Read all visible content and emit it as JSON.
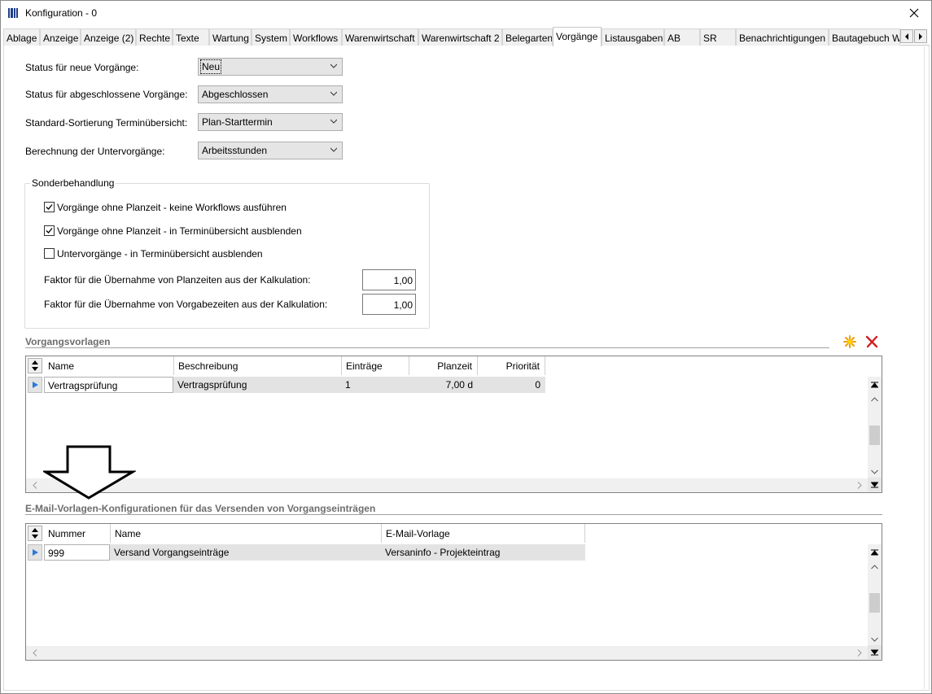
{
  "window": {
    "title": "Konfiguration - 0"
  },
  "tabs": [
    {
      "label": "Ablage"
    },
    {
      "label": "Anzeige"
    },
    {
      "label": "Anzeige (2)"
    },
    {
      "label": "Rechte"
    },
    {
      "label": "Texte"
    },
    {
      "label": "Wartung"
    },
    {
      "label": "System"
    },
    {
      "label": "Workflows"
    },
    {
      "label": "Warenwirtschaft"
    },
    {
      "label": "Warenwirtschaft 2"
    },
    {
      "label": "Belegarten"
    },
    {
      "label": "Vorgänge"
    },
    {
      "label": "Listausgaben"
    },
    {
      "label": "AB"
    },
    {
      "label": "SR"
    },
    {
      "label": "Benachrichtigungen"
    },
    {
      "label": "Bautagebuch W"
    }
  ],
  "active_tab": "Vorgänge",
  "form": {
    "status_new_label": "Status für neue Vorgänge:",
    "status_new_value": "Neu",
    "status_closed_label": "Status für abgeschlossene Vorgänge:",
    "status_closed_value": "Abgeschlossen",
    "sort_label": "Standard-Sortierung Terminübersicht:",
    "sort_value": "Plan-Starttermin",
    "calc_label": "Berechnung der Untervorgänge:",
    "calc_value": "Arbeitsstunden"
  },
  "special": {
    "title": "Sonderbehandlung",
    "cb1_label": "Vorgänge ohne Planzeit - keine Workflows ausführen",
    "cb1_checked": true,
    "cb2_label": "Vorgänge ohne Planzeit - in Terminübersicht ausblenden",
    "cb2_checked": true,
    "cb3_label": "Untervorgänge - in Terminübersicht ausblenden",
    "cb3_checked": false,
    "factor_plan_label": "Faktor für die Übernahme von Planzeiten aus der Kalkulation:",
    "factor_plan_value": "1,00",
    "factor_vorgabe_label": "Faktor für die Übernahme von Vorgabezeiten aus der Kalkulation:",
    "factor_vorgabe_value": "1,00"
  },
  "templates": {
    "title": "Vorgangsvorlagen",
    "columns": {
      "name": "Name",
      "beschreibung": "Beschreibung",
      "eintraege": "Einträge",
      "planzeit": "Planzeit",
      "prioritaet": "Priorität"
    },
    "rows": [
      {
        "name": "Vertragsprüfung",
        "beschreibung": "Vertragsprüfung",
        "eintraege": "1",
        "planzeit": "7,00 d",
        "prioritaet": "0"
      }
    ]
  },
  "email": {
    "title": "E-Mail-Vorlagen-Konfigurationen für das Versenden von Vorgangseinträgen",
    "columns": {
      "nummer": "Nummer",
      "name": "Name",
      "vorlage": "E-Mail-Vorlage"
    },
    "rows": [
      {
        "nummer": "999",
        "name": "Versand Vorgangseinträge",
        "vorlage": "Versaninfo - Projekteintrag"
      }
    ]
  },
  "colors": {
    "add_icon": "#f0a000",
    "delete_icon": "#d02020",
    "row_indicator": "#2a7bd4"
  }
}
